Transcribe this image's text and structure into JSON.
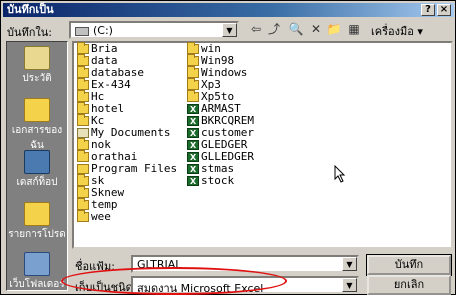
{
  "window": {
    "title": "บันทึกเป็น",
    "help_btn": "?",
    "close_btn": "×"
  },
  "save_in": {
    "label": "บันทึกใน:",
    "value": "(C:)"
  },
  "toolbar": {
    "tools_label": "เครื่องมือ ▾"
  },
  "sidebar": [
    {
      "label": "ประวัติ",
      "icon": "history-icon"
    },
    {
      "label": "เอกสารของฉัน",
      "icon": "my-documents-icon"
    },
    {
      "label": "เดสก์ท็อป",
      "icon": "desktop-icon"
    },
    {
      "label": "รายการโปรด",
      "icon": "favorites-icon"
    },
    {
      "label": "เว็บโฟลเดอร์",
      "icon": "web-folders-icon"
    }
  ],
  "files": {
    "col1": [
      {
        "name": "Bria",
        "type": "folder"
      },
      {
        "name": "data",
        "type": "folder"
      },
      {
        "name": "database",
        "type": "folder"
      },
      {
        "name": "Ex-434",
        "type": "folder"
      },
      {
        "name": "Hc",
        "type": "folder"
      },
      {
        "name": "hotel",
        "type": "folder"
      },
      {
        "name": "Kc",
        "type": "folder"
      },
      {
        "name": "My Documents",
        "type": "docs"
      },
      {
        "name": "nok",
        "type": "folder"
      },
      {
        "name": "orathai",
        "type": "folder"
      },
      {
        "name": "Program Files",
        "type": "prog"
      },
      {
        "name": "sk",
        "type": "folder"
      },
      {
        "name": "Sknew",
        "type": "folder"
      },
      {
        "name": "temp",
        "type": "folder"
      },
      {
        "name": "wee",
        "type": "folder"
      }
    ],
    "col2": [
      {
        "name": "win",
        "type": "folder"
      },
      {
        "name": "Win98",
        "type": "folder"
      },
      {
        "name": "Windows",
        "type": "folder"
      },
      {
        "name": "Xp3",
        "type": "folder"
      },
      {
        "name": "Xp5to",
        "type": "folder"
      },
      {
        "name": "ARMAST",
        "type": "xls"
      },
      {
        "name": "BKRCQREM",
        "type": "xls"
      },
      {
        "name": "customer",
        "type": "xls"
      },
      {
        "name": "GLEDGER",
        "type": "xls"
      },
      {
        "name": "GLLEDGER",
        "type": "xls"
      },
      {
        "name": "stmas",
        "type": "xls"
      },
      {
        "name": "stock",
        "type": "xls"
      }
    ]
  },
  "filename": {
    "label": "ชื่อแฟ้ม:",
    "value": "GLTRIAL"
  },
  "filetype": {
    "label": "เก็บเป็นชนิด:",
    "value": "สมุดงาน Microsoft Excel"
  },
  "buttons": {
    "save": "บันทึก",
    "cancel": "ยกเลิก"
  }
}
